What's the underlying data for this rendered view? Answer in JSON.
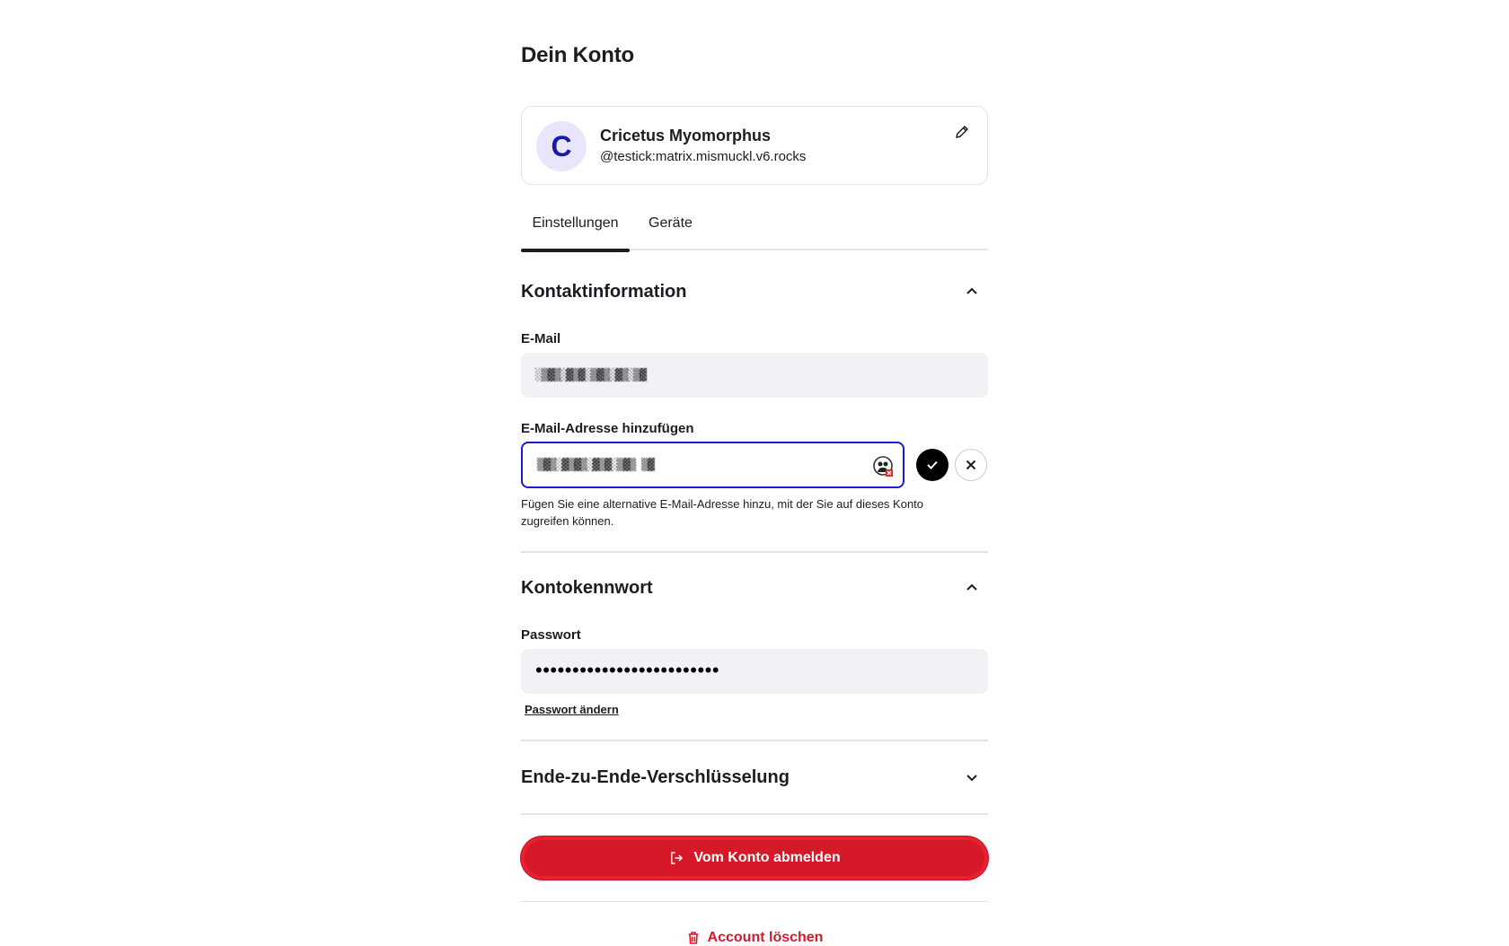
{
  "page": {
    "title": "Dein Konto"
  },
  "profile": {
    "avatar_letter": "C",
    "display_name": "Cricetus Myomorphus",
    "mxid": "@testick:matrix.mismuckl.v6.rocks",
    "edit_icon": "pencil-icon"
  },
  "tabs": [
    {
      "label": "Einstellungen",
      "active": true
    },
    {
      "label": "Geräte",
      "active": false
    }
  ],
  "contact": {
    "title": "Kontaktinformation",
    "expanded": true,
    "email_label": "E-Mail",
    "email_value": "░▒▓▒░▓▒▓░▒▓▒░▓▒░▒▓",
    "add_label": "E-Mail-Adresse hinzufügen",
    "add_value": "▒▓▒░▓▒▓▒░▓▒▓░▒▓▒ ▒▓",
    "help_text": "Fügen Sie eine alternative E-Mail-Adresse hinzu, mit der Sie auf dieses Konto zugreifen können."
  },
  "password": {
    "title": "Kontokennwort",
    "expanded": true,
    "label": "Passwort",
    "value": "•••••••••••••••••••••••••",
    "change_link": "Passwort ändern"
  },
  "e2e": {
    "title": "Ende-zu-Ende-Verschlüsselung",
    "expanded": false
  },
  "actions": {
    "logout": "Vom Konto abmelden",
    "delete": "Account löschen"
  },
  "colors": {
    "accent": "#1a1ad4",
    "danger": "#d51928",
    "field_bg": "#f0f2f5"
  }
}
